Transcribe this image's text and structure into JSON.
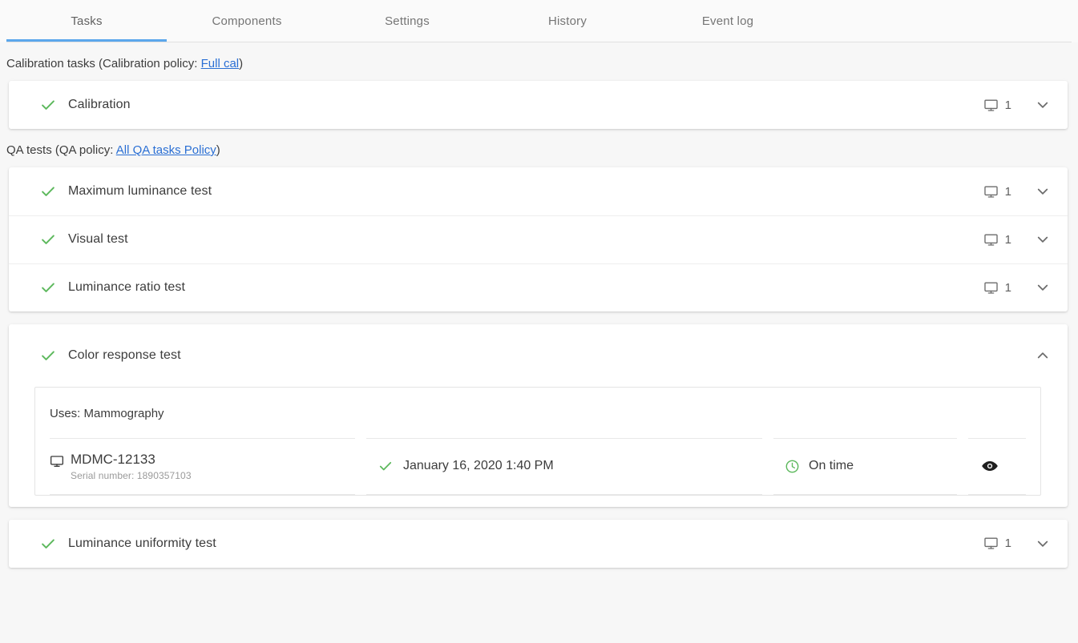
{
  "tabs": [
    {
      "label": "Tasks",
      "active": true
    },
    {
      "label": "Components",
      "active": false
    },
    {
      "label": "Settings",
      "active": false
    },
    {
      "label": "History",
      "active": false
    },
    {
      "label": "Event log",
      "active": false
    }
  ],
  "calibration_section": {
    "prefix": "Calibration tasks (Calibration policy: ",
    "policy_link": "Full cal",
    "suffix": ")",
    "tasks": [
      {
        "label": "Calibration",
        "status": "passed",
        "display_count": "1",
        "expanded": false
      }
    ]
  },
  "qa_section": {
    "prefix": "QA tests (QA policy: ",
    "policy_link": "All QA tasks Policy",
    "suffix": ")",
    "tasks_group_1": [
      {
        "label": "Maximum luminance test",
        "status": "passed",
        "display_count": "1",
        "expanded": false
      },
      {
        "label": "Visual test",
        "status": "passed",
        "display_count": "1",
        "expanded": false
      },
      {
        "label": "Luminance ratio test",
        "status": "passed",
        "display_count": "1",
        "expanded": false
      }
    ],
    "expanded_task": {
      "label": "Color response test",
      "status": "passed",
      "expanded": true,
      "uses_label": "Uses: Mammography",
      "row": {
        "display_name": "MDMC-12133",
        "serial_label": "Serial number: 1890357103",
        "date": "January 16, 2020 1:40 PM",
        "date_status": "passed",
        "schedule_status": "On time",
        "action_icon": "eye-icon"
      }
    },
    "tasks_group_2": [
      {
        "label": "Luminance uniformity test",
        "status": "passed",
        "display_count": "1",
        "expanded": false
      }
    ]
  },
  "icons": {
    "check": "check-icon",
    "monitor": "monitor-icon",
    "chevron_down": "chevron-down-icon",
    "chevron_up": "chevron-up-icon",
    "clock": "clock-icon",
    "eye": "eye-icon"
  },
  "colors": {
    "accent": "#5ba7ec",
    "link": "#2a6fd4",
    "success": "#5cb85c",
    "text": "#3c3c3c",
    "muted": "#9a9a9a",
    "background": "#f7f7f7",
    "card": "#ffffff"
  }
}
